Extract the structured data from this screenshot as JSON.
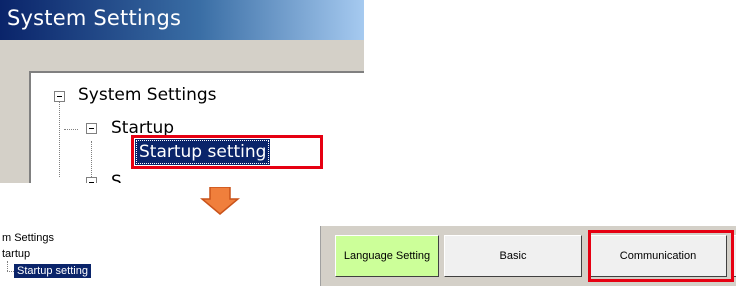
{
  "top_window": {
    "title": "System Settings",
    "tree": {
      "root_label": "System Settings",
      "child_label": "Startup",
      "selected_label": "Startup setting",
      "next_label_partial": "S"
    }
  },
  "arrow": {
    "icon": "down-arrow-icon",
    "color": "#f07f3c"
  },
  "bottom_strip": {
    "tree": {
      "root_label": "m Settings",
      "child_label": "tartup",
      "selected_label": "Startup setting"
    },
    "tabs": [
      {
        "label": "Language Setting",
        "highlighted": true
      },
      {
        "label": "Basic",
        "highlighted": false
      },
      {
        "label": "Communication",
        "highlighted": false
      }
    ]
  },
  "colors": {
    "selection": "#0a246a",
    "highlight_box": "#e60012",
    "active_tab": "#ccff99"
  }
}
